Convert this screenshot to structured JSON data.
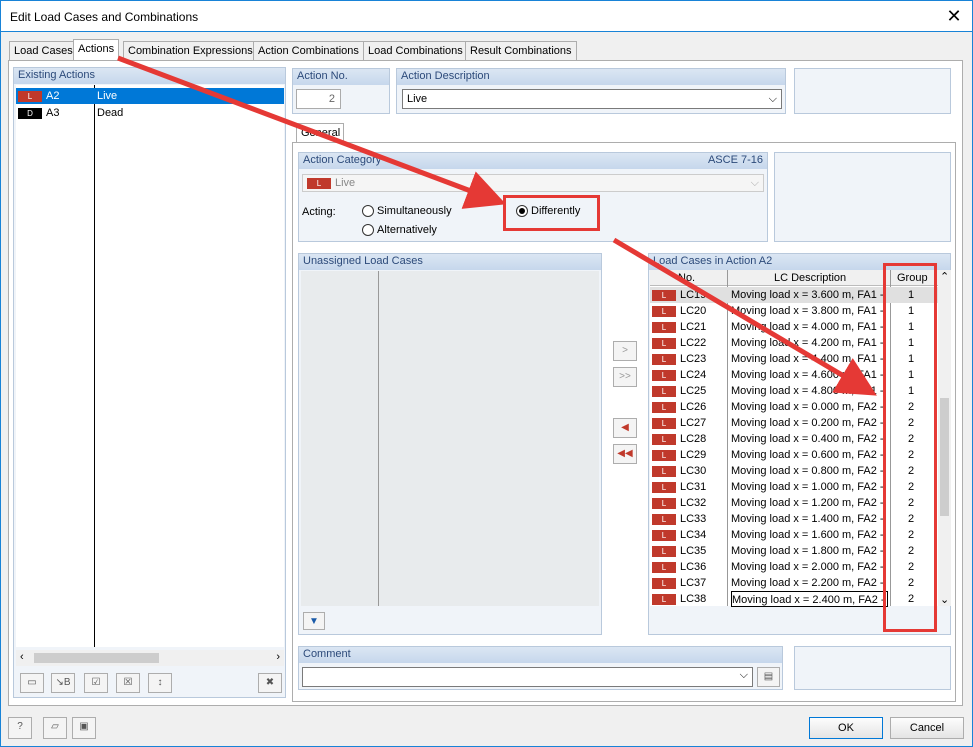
{
  "window": {
    "title": "Edit Load Cases and Combinations"
  },
  "tabs": [
    {
      "label": "Load Cases"
    },
    {
      "label": "Actions"
    },
    {
      "label": "Combination Expressions"
    },
    {
      "label": "Action Combinations"
    },
    {
      "label": "Load Combinations"
    },
    {
      "label": "Result Combinations"
    }
  ],
  "existing_actions": {
    "header": "Existing Actions",
    "items": [
      {
        "tag": "L",
        "id": "A2",
        "name": "Live"
      },
      {
        "tag": "D",
        "id": "A3",
        "name": "Dead"
      }
    ]
  },
  "action_no": {
    "label": "Action No.",
    "value": "2"
  },
  "action_description": {
    "label": "Action Description",
    "value": "Live"
  },
  "general_tab": "General",
  "action_category": {
    "label": "Action Category",
    "standard": "ASCE 7-16",
    "tag": "L",
    "value": "Live"
  },
  "acting": {
    "label": "Acting:",
    "simultaneously": "Simultaneously",
    "alternatively": "Alternatively",
    "differently": "Differently"
  },
  "unassigned": {
    "header": "Unassigned Load Cases"
  },
  "lc_table": {
    "header": "Load Cases in Action A2",
    "col_no": "No.",
    "col_desc": "LC Description",
    "col_group": "Group",
    "rows": [
      {
        "no": "LC19",
        "desc": "Moving load x = 3.600 m, FA1 -",
        "group": "1"
      },
      {
        "no": "LC20",
        "desc": "Moving load x = 3.800 m, FA1 -",
        "group": "1"
      },
      {
        "no": "LC21",
        "desc": "Moving load x = 4.000 m, FA1 -",
        "group": "1"
      },
      {
        "no": "LC22",
        "desc": "Moving load x = 4.200 m, FA1 -",
        "group": "1"
      },
      {
        "no": "LC23",
        "desc": "Moving load x = 4.400 m, FA1 -",
        "group": "1"
      },
      {
        "no": "LC24",
        "desc": "Moving load x = 4.600 m, FA1 -",
        "group": "1"
      },
      {
        "no": "LC25",
        "desc": "Moving load x = 4.800 m, FA1 -",
        "group": "1"
      },
      {
        "no": "LC26",
        "desc": "Moving load x = 0.000 m, FA2 -",
        "group": "2"
      },
      {
        "no": "LC27",
        "desc": "Moving load x = 0.200 m, FA2 -",
        "group": "2"
      },
      {
        "no": "LC28",
        "desc": "Moving load x = 0.400 m, FA2 -",
        "group": "2"
      },
      {
        "no": "LC29",
        "desc": "Moving load x = 0.600 m, FA2 -",
        "group": "2"
      },
      {
        "no": "LC30",
        "desc": "Moving load x = 0.800 m, FA2 -",
        "group": "2"
      },
      {
        "no": "LC31",
        "desc": "Moving load x = 1.000 m, FA2 -",
        "group": "2"
      },
      {
        "no": "LC32",
        "desc": "Moving load x = 1.200 m, FA2 -",
        "group": "2"
      },
      {
        "no": "LC33",
        "desc": "Moving load x = 1.400 m, FA2 -",
        "group": "2"
      },
      {
        "no": "LC34",
        "desc": "Moving load x = 1.600 m, FA2 -",
        "group": "2"
      },
      {
        "no": "LC35",
        "desc": "Moving load x = 1.800 m, FA2 -",
        "group": "2"
      },
      {
        "no": "LC36",
        "desc": "Moving load x = 2.000 m, FA2 -",
        "group": "2"
      },
      {
        "no": "LC37",
        "desc": "Moving load x = 2.200 m, FA2 -",
        "group": "2"
      },
      {
        "no": "LC38",
        "desc": "Moving load x = 2.400 m, FA2 -",
        "group": "2"
      }
    ]
  },
  "comment": {
    "label": "Comment"
  },
  "buttons": {
    "ok": "OK",
    "cancel": "Cancel"
  },
  "colors": {
    "accent": "#0078d7",
    "annotation": "#e53935",
    "load_tag": "#c0392b"
  }
}
